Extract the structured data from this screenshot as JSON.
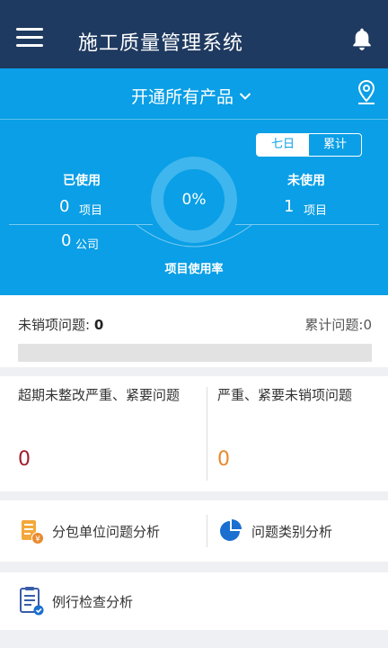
{
  "header": {
    "title": "施工质量管理系统",
    "menu_icon": "menu-icon",
    "bell_icon": "bell-icon"
  },
  "product_bar": {
    "selected": "开通所有产品",
    "location_icon": "location-pin-icon"
  },
  "period_toggle": {
    "options": [
      "七日",
      "累计"
    ],
    "selected": "七日"
  },
  "usage": {
    "used_label": "已使用",
    "used_projects": "0",
    "project_unit": "项目",
    "used_companies": "0",
    "company_unit": "公司",
    "unused_label": "未使用",
    "unused_projects": "1",
    "rate_value": "0%",
    "rate_fraction": 0,
    "rate_caption": "项目使用率"
  },
  "issues": {
    "open_label": "未销项问题:",
    "open_count": "0",
    "total_text": "累计问题:0",
    "progress_fraction": 0
  },
  "overdue": {
    "left_title": "超期未整改严重、紧要问题",
    "left_value": "0",
    "right_title": "严重、紧要未销项问题",
    "right_value": "0",
    "colors": {
      "left": "#a11d2b",
      "right": "#e8892e"
    }
  },
  "analysis": {
    "subcontractor": "分包单位问题分析",
    "category": "问题类别分析",
    "routine": "例行检查分析"
  },
  "colors": {
    "header_bg": "#1f3a60",
    "accent": "#0a9fe6"
  }
}
